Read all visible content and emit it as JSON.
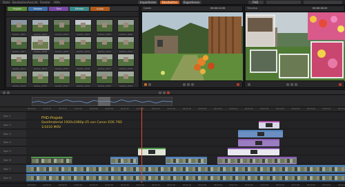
{
  "menu": {
    "items": [
      "Datei",
      "Bearbeiten",
      "Ansicht",
      "Fenster",
      "Hilfe"
    ],
    "center_tabs": [
      "Importieren",
      "Bearbeiten",
      "Exportieren"
    ],
    "right_label": "FHD"
  },
  "library": {
    "tabs": [
      "Projekt",
      "Medien",
      "Titel",
      "Effekte",
      "Audio"
    ],
    "selected_label": "Garten_2008",
    "clips": [
      {
        "label": "Garten_2001",
        "sky": "#8b98a4",
        "grass": "#4b6a37"
      },
      {
        "label": "Garten_2002",
        "sky": "#a2adb6",
        "grass": "#536f3c"
      },
      {
        "label": "Garten_2003",
        "sky": "#6e7c63",
        "grass": "#3f5c2f"
      },
      {
        "label": "Garten_2004",
        "sky": "#c2c7cc",
        "grass": "#5a7b43"
      },
      {
        "label": "Garten_2005",
        "sky": "#7f8d74",
        "grass": "#4e6c39"
      },
      {
        "label": "Garten_2006",
        "sky": "#9aa39a",
        "grass": "#56733f"
      },
      {
        "label": "Garten_2007",
        "sky": "#8d9a8a",
        "grass": "#45643a"
      },
      {
        "label": "Garten_2008",
        "sky": "#b7bcb6",
        "grass": "#6b7c4d"
      },
      {
        "label": "Garten_2009",
        "sky": "#7a8876",
        "grass": "#4d6a3b"
      },
      {
        "label": "Garten_2010",
        "sky": "#a8b1a4",
        "grass": "#577542"
      },
      {
        "label": "Garten_2011",
        "sky": "#8e9a89",
        "grass": "#4a683a"
      },
      {
        "label": "Garten_2012",
        "sky": "#9aa296",
        "grass": "#5d7a45"
      },
      {
        "label": "Garten_2013",
        "sky": "#b2b8ae",
        "grass": "#50703e"
      },
      {
        "label": "Garten_2014",
        "sky": "#7f8b7d",
        "grass": "#48663a"
      },
      {
        "label": "Garten_2015",
        "sky": "#a6ad9f",
        "grass": "#5b7843"
      },
      {
        "label": "Garten_2016",
        "sky": "#8a9686",
        "grass": "#4f6d3b"
      },
      {
        "label": "Garten_2017",
        "sky": "#9ea69a",
        "grass": "#566f40"
      },
      {
        "label": "Garten_2018",
        "sky": "#b0b6ac",
        "grass": "#52713f"
      },
      {
        "label": "Garten_2019",
        "sky": "#838f80",
        "grass": "#4b6939"
      },
      {
        "label": "Garten_2020",
        "sky": "#a0a89c",
        "grass": "#5a7644"
      },
      {
        "label": "Garten_2021",
        "sky": "#949d90",
        "grass": "#4e6b3c"
      },
      {
        "label": "Garten_2022",
        "sky": "#adb3a9",
        "grass": "#55733f"
      },
      {
        "label": "Garten_2023",
        "sky": "#8c978a",
        "grass": "#4a6839"
      },
      {
        "label": "Garten_2024",
        "sky": "#a3ab9f",
        "grass": "#587542"
      }
    ]
  },
  "source_monitor": {
    "title": "Quelle",
    "timecode": "00:00:12:05"
  },
  "program_monitor": {
    "title": "Timeline",
    "timecode": "00:00:18:15"
  },
  "timeline": {
    "tracks": [
      "Spur 1",
      "Spur 2",
      "Spur 3",
      "Spur 4",
      "Spur 5",
      "Spur 6",
      "Spur 7",
      "Spur 8"
    ],
    "title_lines": [
      "FHD-Projekt",
      "Quellmaterial 1920x1080p-25 von Canon EOS 70D",
      "1/1010 MOV"
    ],
    "ruler_ticks": [
      "00:00:00",
      "00:00:10",
      "00:00:20",
      "00:00:30",
      "00:00:40",
      "00:00:50",
      "00:01:00",
      "00:01:10",
      "00:01:20",
      "00:01:30",
      "00:01:40",
      "00:01:50",
      "00:02:00",
      "00:02:10",
      "00:02:20",
      "00:02:30",
      "00:02:40",
      "00:02:50",
      "00:03:00",
      "00:03:10",
      "00:03:20"
    ]
  },
  "colors": {
    "clip_blue": "#4e7fb8",
    "clip_purple": "#8a5bb0",
    "clip_green": "#4f9a4f",
    "clip_magenta": "#b04aa6",
    "accent_orange": "#d06a1e",
    "title_yellow": "#e6c23a"
  },
  "icons": {
    "play": "play-icon",
    "stop": "stop-icon",
    "record": "record-icon"
  }
}
